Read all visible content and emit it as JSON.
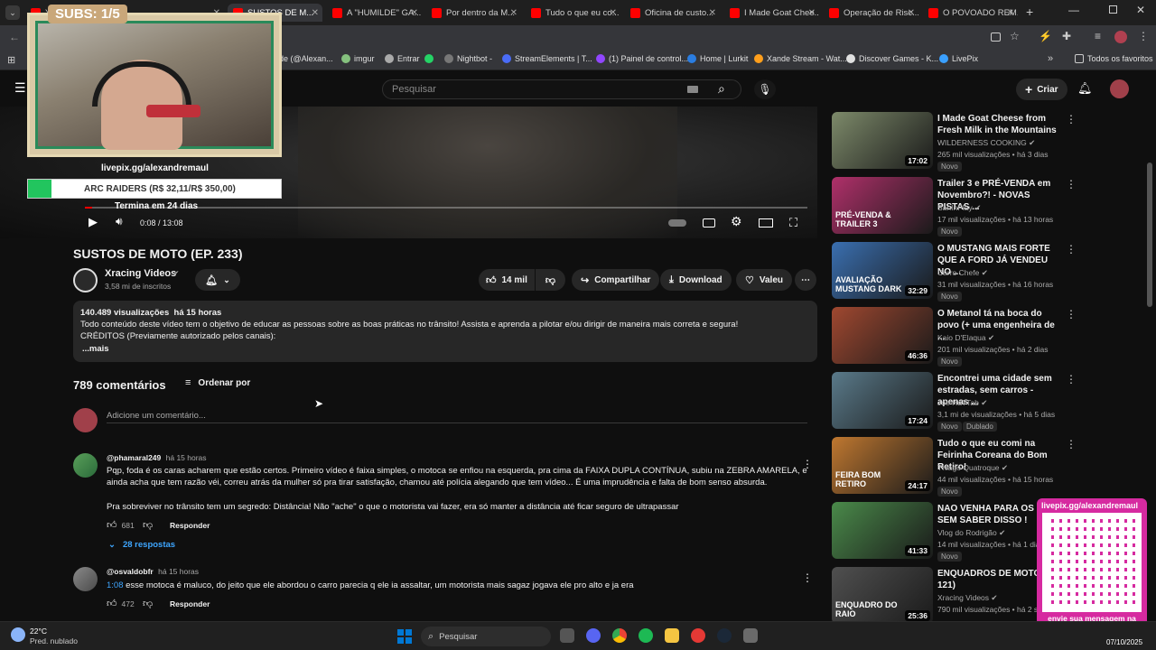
{
  "browser": {
    "tabs": [
      {
        "label": "Y...",
        "color": "#ff0000"
      },
      {
        "label": "SUSTOS DE M...",
        "color": "#ff0000",
        "active": true
      },
      {
        "label": "A \"HUMILDE\" GA...",
        "color": "#ff0000"
      },
      {
        "label": "Por dentro da M...",
        "color": "#ff0000"
      },
      {
        "label": "Tudo o que eu co...",
        "color": "#ff0000"
      },
      {
        "label": "Oficina de custo...",
        "color": "#ff0000"
      },
      {
        "label": "I Made Goat Chee...",
        "color": "#ff0000"
      },
      {
        "label": "Operação de Risc...",
        "color": "#ff0000"
      },
      {
        "label": "O POVOADO REM...",
        "color": "#ff0000"
      }
    ],
    "bookmarks": [
      "nde (@Alexan...",
      "imgur",
      "Entrar",
      "",
      "Nightbot -",
      "StreamElements | T...",
      "(1) Painel de control...",
      "Home | Lurkit",
      "Xande Stream - Wat...",
      "Discover Games - K...",
      "LivePix"
    ],
    "all_favorites": "Todos os favoritos"
  },
  "header": {
    "search_placeholder": "Pesquisar",
    "create_label": "Criar"
  },
  "stream_overlay": {
    "subs": "SUBS: 1/5",
    "livepix_url": "livepix.gg/alexandremaul",
    "goal": "ARC RAIDERS (R$ 32,11/R$ 350,00)",
    "goal_fraction": 0.0917,
    "goal_end": "Termina em 24 dias",
    "qr_title": "livepix.gg/alexandremaul",
    "qr_caption": "envie sua mensagem na live via pix!"
  },
  "player": {
    "time": "0:08 / 13:08",
    "progress_fraction": 0.0102
  },
  "video": {
    "title": "SUSTOS DE MOTO (EP. 233)",
    "channel": "Xracing Videos",
    "subscribers": "3,58 mi de inscritos",
    "likes": "14 mil",
    "share": "Compartilhar",
    "download": "Download",
    "thanks": "Valeu",
    "views_line": "140.489 visualizações  há 15 horas",
    "description_line1": "Todo conteúdo deste vídeo tem o objetivo de educar as pessoas sobre as boas práticas no trânsito! Assista e aprenda a pilotar e/ou dirigir de maneira mais correta e segura!",
    "description_line2": "CRÉDITOS (Previamente autorizado pelos canais):",
    "more": "...mais"
  },
  "comments": {
    "count": "789 comentários",
    "sort": "Ordenar por",
    "add_placeholder": "Adicione um comentário...",
    "items": [
      {
        "author": "@phamaral249",
        "time": "há 15 horas",
        "text1": "Pqp, foda é os caras acharem que estão certos. Primeiro vídeo é faixa simples, o motoca se enfiou na esquerda, pra cima da FAIXA DUPLA CONTÍNUA, subiu na ZEBRA AMARELA, e",
        "text2": "ainda acha que tem razão véi, correu atrás da mulher só pra tirar satisfação, chamou até polícia alegando que tem vídeo... É uma imprudência e falta de bom senso absurda.",
        "text3": "Pra sobreviver no trânsito tem um segredo: Distância! Não \"ache\" o que o motorista vai fazer, era só manter a distância até ficar seguro de ultrapassar",
        "likes": "681",
        "reply": "Responder",
        "replies": "28 respostas"
      },
      {
        "author": "@osvaldobfr",
        "time": "há 15 horas",
        "timestamp": "1:08",
        "text1": " esse motoca é maluco, do jeito que ele abordou o carro parecia q ele ia assaltar, um motorista mais sagaz jogava ele pro alto e ja era",
        "likes": "472",
        "reply": "Responder"
      }
    ]
  },
  "suggestions": [
    {
      "title": "I Made Goat Cheese from Fresh Milk in the Mountains",
      "channel": "WILDERNESS COOKING",
      "meta": "265 mil visualizações • há 3 dias",
      "duration": "17:02",
      "badge": "Novo",
      "color": "#7d8a6a"
    },
    {
      "title": "Trailer 3 e PRÉ-VENDA em Novembro?! - NOVAS PISTAS ...",
      "channel": "SanInPlay",
      "meta": "17 mil visualizações • há 13 horas",
      "duration": "",
      "badge": "Novo",
      "color": "#b0306a",
      "thumb_text": "PRÉ-VENDA & TRAILER 3"
    },
    {
      "title": "O MUSTANG MAIS FORTE QUE A FORD JÁ VENDEU NO ...",
      "channel": "Carro Chefe",
      "meta": "31 mil visualizações • há 16 horas",
      "duration": "32:29",
      "badge": "Novo",
      "color": "#3a6fb0",
      "thumb_text": "AVALIAÇÃO MUSTANG DARK"
    },
    {
      "title": "O Metanol tá na boca do povo (+ uma engenheira de ...",
      "channel": "Kaio D'Elaqua",
      "meta": "201 mil visualizações • há 2 dias",
      "duration": "46:36",
      "badge": "Novo",
      "color": "#a04830"
    },
    {
      "title": "Encontrei uma cidade sem estradas, sem carros - apenas ...",
      "channel": "Joe HaTTab",
      "meta": "3,1 mi de visualizações • há 5 dias",
      "duration": "17:24",
      "badge": "Novo",
      "badge2": "Dublado",
      "color": "#5a7a8a"
    },
    {
      "title": "Tudo o que eu comi na Feirinha Coreana do Bom Retiro!",
      "channel": "Thiago Quatroque",
      "meta": "44 mil visualizações • há 15 horas",
      "duration": "24:17",
      "badge": "Novo",
      "color": "#c07830",
      "thumb_text": "FEIRA BOM RETIRO"
    },
    {
      "title": "NAO VENHA PARA OS EUA SEM SABER DISSO !",
      "channel": "Vlog do Rodrigão",
      "meta": "14 mil visualizações • há 1 dia",
      "duration": "41:33",
      "badge": "Novo",
      "color": "#4a8a4a"
    },
    {
      "title": "ENQUADROS DE MOTO (EP. 121)",
      "channel": "Xracing Videos",
      "meta": "790 mil visualizações • há 2 se...",
      "duration": "25:36",
      "badge": "",
      "color": "#505050",
      "thumb_text": "ENQUADRO DO RAIO"
    }
  ],
  "taskbar": {
    "temp": "22°C",
    "weather": "Pred. nublado",
    "search": "Pesquisar",
    "date": "07/10/2025"
  }
}
